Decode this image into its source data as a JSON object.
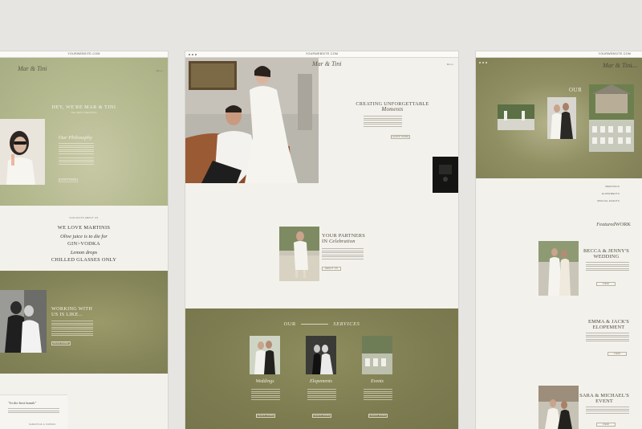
{
  "left_page": {
    "url": "YOURWEBSITE.COM",
    "logo": "Mar & Tini",
    "menu_label": "Menu",
    "hero_heading": "HEY, WE'RE MAR & TINI",
    "hero_sub": "THE BEST WEDDING",
    "philosophy_title": "Our Philosophy",
    "philosophy_button": "LEARN MORE",
    "about_eyebrow": "FUN FACTS ABOUT US",
    "facts": [
      "WE LOVE MARTINIS",
      "Olive juice is to die for",
      "GIN>VODKA",
      "Lemon drops",
      "CHILLED GLASSES ONLY"
    ],
    "working_title": [
      "WORKING WITH",
      "US IS LIKE..."
    ],
    "working_button": "READ MORE",
    "testimonial_quote": "\"In the best hands\"",
    "testimonial_author": "SAMANTHA & JORDAN"
  },
  "middle_page": {
    "url": "YOURWEBSITE.COM",
    "logo": "Mar & Tini",
    "menu_label": "Menu",
    "hero_title": "CREATING UNFORGETTABLE",
    "hero_title_script": "Moments",
    "hero_button": "LEARN MORE",
    "partners_title": [
      "YOUR PARTNERS",
      "IN"
    ],
    "partners_script": "Celebration",
    "partners_button": "ABOUT US",
    "services_our": "OUR",
    "services_title": "SERVICES",
    "services": [
      {
        "label": "Weddings",
        "button": "LEARN MORE"
      },
      {
        "label": "Elopements",
        "button": "LEARN MORE"
      },
      {
        "label": "Events",
        "button": "LEARN MORE"
      }
    ]
  },
  "right_page": {
    "url": "YOURWEBSITE.COM",
    "logo": "Mar & Tini",
    "menu_label": "Menu",
    "hero_our": "OUR",
    "nav": [
      "WEDDINGS",
      "ELOPEMENTS",
      "SPECIAL EVENTS"
    ],
    "featured_script": "Featured",
    "featured_title": "WORK",
    "items": [
      {
        "title": [
          "BECCA & JENNY'S",
          "WEDDING"
        ],
        "button": "VIEW"
      },
      {
        "title": [
          "EMMA & JACK'S",
          "ELOPEMENT"
        ],
        "button": "VIEW"
      },
      {
        "title": [
          "SARA & MICHAEL'S",
          "EVENT"
        ],
        "button": "VIEW"
      }
    ]
  },
  "colors": {
    "sage": "#b4b98e",
    "olive": "#7d7c51",
    "cream": "#f3f1ec",
    "background": "#e6e5e1",
    "text_dark": "#3a3a32"
  }
}
